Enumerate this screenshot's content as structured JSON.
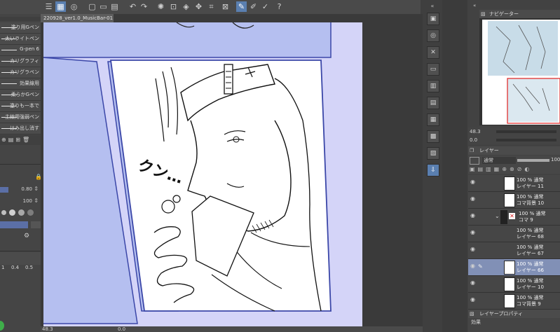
{
  "document": {
    "tab_title": "220928_ver1.0_MusicBar-01"
  },
  "status": {
    "zoom": "48.3",
    "rotation": "0.0"
  },
  "brush_list": [
    {
      "label": "塗り用Gペン"
    },
    {
      "label": "太いライトペン"
    },
    {
      "label": "G-pen 6"
    },
    {
      "label": "カリグラフィ"
    },
    {
      "label": "カリグラペン"
    },
    {
      "label": "効果線用"
    },
    {
      "label": "柔らかGペン"
    },
    {
      "label": "塗りも一本で"
    },
    {
      "label": "主線用強弱ペン"
    },
    {
      "label": "はみ出し消す"
    }
  ],
  "tool_property": {
    "size_value": "0.80",
    "opacity_value": "100",
    "stabilizer_values": [
      "1",
      "0.4",
      "0.5"
    ]
  },
  "comic_sfx": "クン…",
  "navigator": {
    "title": "ナビゲーター",
    "zoom": "48.3",
    "rotation": "0.0"
  },
  "layer_panel": {
    "title": "レイヤー",
    "blend_mode": "通常",
    "opacity": "100",
    "layers": [
      {
        "line1": "100 % 通常",
        "line2": "レイヤー 11",
        "selected": false
      },
      {
        "line1": "100 % 通常",
        "line2": "コマ背景 10",
        "selected": false
      },
      {
        "line1": "100 % 通常",
        "line2": "コマ 9",
        "selected": false,
        "folder": true
      },
      {
        "line1": "100 % 通常",
        "line2": "レイヤー 68",
        "selected": false
      },
      {
        "line1": "100 % 通常",
        "line2": "レイヤー 67",
        "selected": false
      },
      {
        "line1": "100 % 通常",
        "line2": "レイヤー 66",
        "selected": true
      },
      {
        "line1": "100 % 通常",
        "line2": "レイヤー 10",
        "selected": false
      },
      {
        "line1": "100 % 通常",
        "line2": "コマ背景 9",
        "selected": false
      }
    ]
  },
  "layer_property": {
    "title": "レイヤープロパティ",
    "effect_label": "効果"
  },
  "colors": {
    "paper": "#d4d4f8",
    "panel_border": "#3b47a8",
    "selected_layer": "#8190b6",
    "active_tool": "#5a7fb0"
  }
}
